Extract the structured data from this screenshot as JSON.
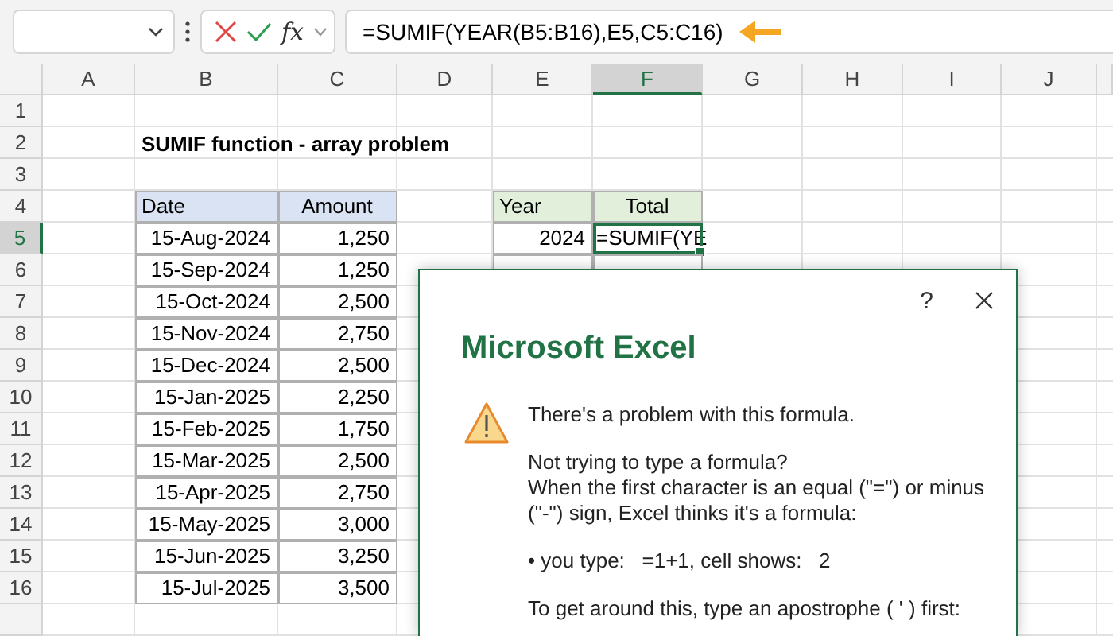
{
  "formula_bar": {
    "function_label": "fx",
    "formula": "=SUMIF(YEAR(B5:B16),E5,C5:C16)"
  },
  "columns": [
    {
      "label": "A",
      "selected": false
    },
    {
      "label": "B",
      "selected": false
    },
    {
      "label": "C",
      "selected": false
    },
    {
      "label": "D",
      "selected": false
    },
    {
      "label": "E",
      "selected": false
    },
    {
      "label": "F",
      "selected": true
    },
    {
      "label": "G",
      "selected": false
    },
    {
      "label": "H",
      "selected": false
    },
    {
      "label": "I",
      "selected": false
    },
    {
      "label": "J",
      "selected": false
    }
  ],
  "rows": [
    {
      "label": "1",
      "selected": false
    },
    {
      "label": "2",
      "selected": false
    },
    {
      "label": "3",
      "selected": false
    },
    {
      "label": "4",
      "selected": false
    },
    {
      "label": "5",
      "selected": true
    },
    {
      "label": "6",
      "selected": false
    },
    {
      "label": "7",
      "selected": false
    },
    {
      "label": "8",
      "selected": false
    },
    {
      "label": "9",
      "selected": false
    },
    {
      "label": "10",
      "selected": false
    },
    {
      "label": "11",
      "selected": false
    },
    {
      "label": "12",
      "selected": false
    },
    {
      "label": "13",
      "selected": false
    },
    {
      "label": "14",
      "selected": false
    },
    {
      "label": "15",
      "selected": false
    },
    {
      "label": "16",
      "selected": false
    }
  ],
  "sheet_title": "SUMIF function - array problem",
  "data_table": {
    "columns": [
      "Date",
      "Amount"
    ],
    "rows": [
      [
        "15-Aug-2024",
        "1,250"
      ],
      [
        "15-Sep-2024",
        "1,250"
      ],
      [
        "15-Oct-2024",
        "2,500"
      ],
      [
        "15-Nov-2024",
        "2,750"
      ],
      [
        "15-Dec-2024",
        "2,500"
      ],
      [
        "15-Jan-2025",
        "2,250"
      ],
      [
        "15-Feb-2025",
        "1,750"
      ],
      [
        "15-Mar-2025",
        "2,500"
      ],
      [
        "15-Apr-2025",
        "2,750"
      ],
      [
        "15-May-2025",
        "3,000"
      ],
      [
        "15-Jun-2025",
        "3,250"
      ],
      [
        "15-Jul-2025",
        "3,500"
      ]
    ]
  },
  "summary_table": {
    "columns": [
      "Year",
      "Total"
    ],
    "rows": [
      {
        "year": "2024",
        "total": "=SUMIF(YE",
        "active": true
      },
      {
        "active": false
      }
    ]
  },
  "dialog": {
    "help": "?",
    "title": "Microsoft Excel",
    "paragraphs": [
      [
        "There's a problem with this formula."
      ],
      [
        "Not trying to type a formula?",
        "When the first character is an equal (\"=\") or minus",
        "(\"-\") sign, Excel thinks it's a formula:"
      ],
      [
        "• you type:   =1+1, cell shows:   2"
      ],
      [
        "To get around this, type an apostrophe ( ' ) first:"
      ]
    ]
  }
}
